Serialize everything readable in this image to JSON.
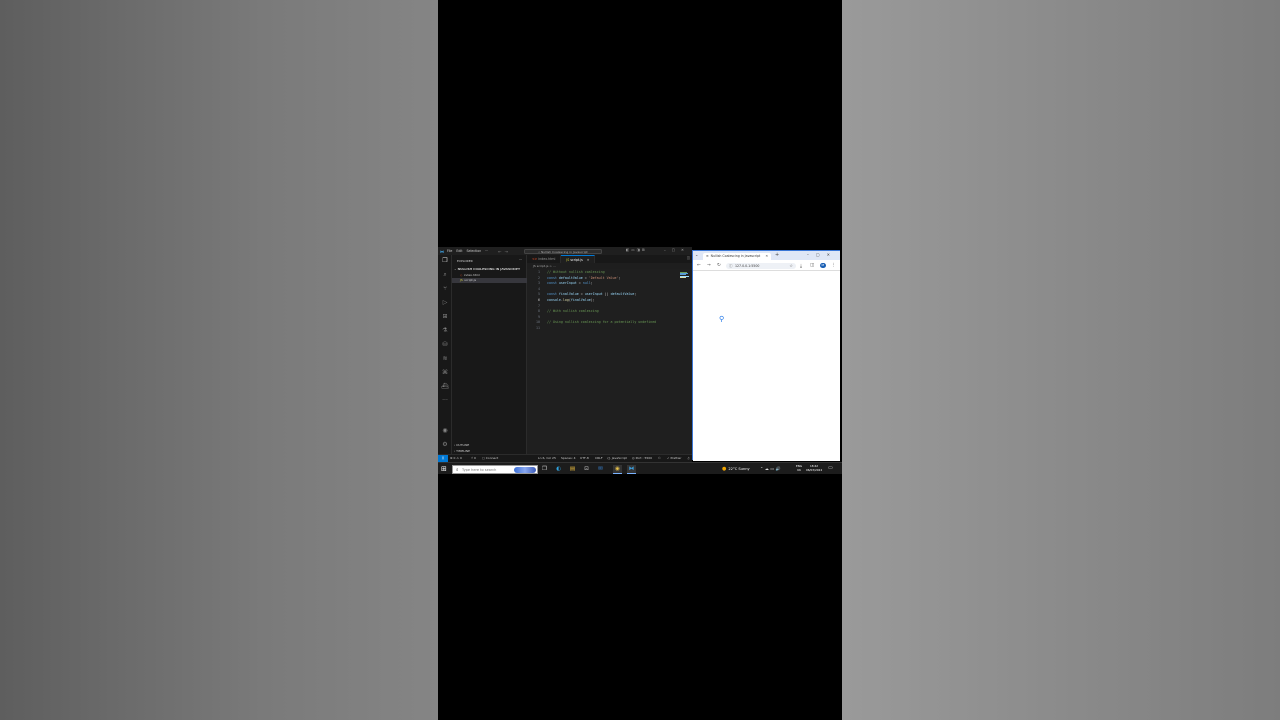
{
  "vscode": {
    "menu": [
      "File",
      "Edit",
      "Selection",
      "···"
    ],
    "search_text": "Nullish Coalescing in Javascript",
    "explorer_title": "EXPLORER",
    "explorer_more": "···",
    "folder_name": "NULLISH COALESCING IN JAVASCRIPT",
    "files": [
      {
        "name": "index.html",
        "icon": "html-file-icon"
      },
      {
        "name": "script.js",
        "icon": "js-file-icon"
      }
    ],
    "outline_label": "OUTLINE",
    "timeline_label": "TIMELINE",
    "tabs": [
      {
        "label": "index.html",
        "icon": "<>"
      },
      {
        "label": "script.js",
        "icon": "JS"
      }
    ],
    "breadcrumb": "JS script.js > ...",
    "code": [
      {
        "n": "1",
        "parts": [
          {
            "t": "// Without nullish coalescing",
            "c": "cm"
          }
        ]
      },
      {
        "n": "2",
        "parts": [
          {
            "t": "const ",
            "c": "kw"
          },
          {
            "t": "defaultValue",
            "c": "vr"
          },
          {
            "t": " = ",
            "c": "pu"
          },
          {
            "t": "'Default Value'",
            "c": "st"
          },
          {
            "t": ";",
            "c": "pu"
          }
        ]
      },
      {
        "n": "3",
        "parts": [
          {
            "t": "const ",
            "c": "kw"
          },
          {
            "t": "userInput",
            "c": "vr"
          },
          {
            "t": " = ",
            "c": "pu"
          },
          {
            "t": "null",
            "c": "kw"
          },
          {
            "t": ";",
            "c": "pu"
          }
        ]
      },
      {
        "n": "4",
        "parts": []
      },
      {
        "n": "5",
        "parts": [
          {
            "t": "const ",
            "c": "kw"
          },
          {
            "t": "finalValue",
            "c": "vr"
          },
          {
            "t": " = ",
            "c": "pu"
          },
          {
            "t": "userInput",
            "c": "vr"
          },
          {
            "t": " || ",
            "c": "pu"
          },
          {
            "t": "defaultValue",
            "c": "vr"
          },
          {
            "t": ";",
            "c": "pu"
          }
        ]
      },
      {
        "n": "6",
        "parts": [
          {
            "t": "console",
            "c": "vr"
          },
          {
            "t": ".",
            "c": "pu"
          },
          {
            "t": "log",
            "c": "fn"
          },
          {
            "t": "(",
            "c": "pu"
          },
          {
            "t": "finalValue",
            "c": "vr"
          },
          {
            "t": ");",
            "c": "pu"
          }
        ]
      },
      {
        "n": "7",
        "parts": []
      },
      {
        "n": "8",
        "parts": [
          {
            "t": "// With nullish coalescing",
            "c": "cm"
          }
        ]
      },
      {
        "n": "9",
        "parts": []
      },
      {
        "n": "10",
        "parts": [
          {
            "t": "// Using nullish coalescing for a potentially undefined",
            "c": "cm"
          }
        ]
      },
      {
        "n": "11",
        "parts": []
      }
    ],
    "current_line": "6",
    "status": {
      "errors": "⊗ 0 ⚠ 0",
      "ports": "⚡ 0",
      "connect": "Connect",
      "position": "Ln 6, Col 25",
      "spaces": "Spaces: 4",
      "encoding": "UTF-8",
      "eol": "CRLF",
      "language": "{} JavaScript",
      "port": "Port : 5500",
      "prettier": "✓ Prettier"
    }
  },
  "chrome": {
    "tab_title": "Nullish Coalescing in Javascript",
    "url": "127.0.0.1:5500",
    "profile_initial": "M"
  },
  "taskbar": {
    "search_placeholder": "Type here to search",
    "weather": "22°C  Sunny",
    "lang_top": "ENG",
    "lang_bottom": "UK",
    "time": "18:42",
    "date": "06/03/2024"
  },
  "colors": {
    "accent": "#0078d4",
    "editor_bg": "#1f1f1f",
    "comment": "#6a9955",
    "keyword": "#569cd6",
    "string": "#ce9178"
  }
}
